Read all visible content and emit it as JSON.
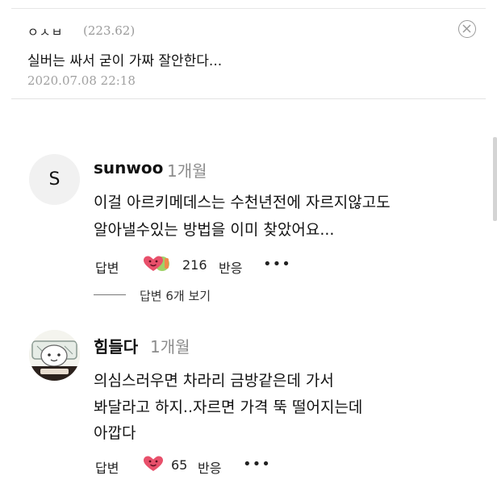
{
  "previous_comment": {
    "author": "ㅇㅅㅂ",
    "score": "(223.62)",
    "text": "실버는 싸서 굳이 가짜 잘안한다...",
    "date": "2020.07.08 22:18",
    "close_icon": "circle-close-icon"
  },
  "comments": [
    {
      "avatar_letter": "S",
      "author": "sunwoo",
      "time": "1개월",
      "lines": [
        "이걸 아르키메데스는 수천년전에 자르지않고도",
        "알아낼수있는 방법을 이미 찾았어요..."
      ],
      "reply_label": "답변",
      "reaction_count": "216",
      "reaction_label": "반응",
      "more_label": "•••",
      "replies_label": "답변 6개 보기",
      "reaction_icons": [
        "heart-face-icon",
        "green-face-icon"
      ]
    },
    {
      "avatar_icon": "cartoon-avatar",
      "author": "힘들다",
      "time": "1개월",
      "lines": [
        "의심스러우면 차라리 금방같은데 가서",
        "봐달라고 하지..자르면 가격 뚝 떨어지는데",
        "아깝다"
      ],
      "reply_label": "답변",
      "reaction_count": "65",
      "reaction_label": "반응",
      "more_label": "•••",
      "reaction_icons": [
        "heart-face-icon"
      ]
    }
  ],
  "colors": {
    "muted": "#9a9a9a",
    "heart": "#e8506b",
    "green_face": "#9fd267"
  }
}
